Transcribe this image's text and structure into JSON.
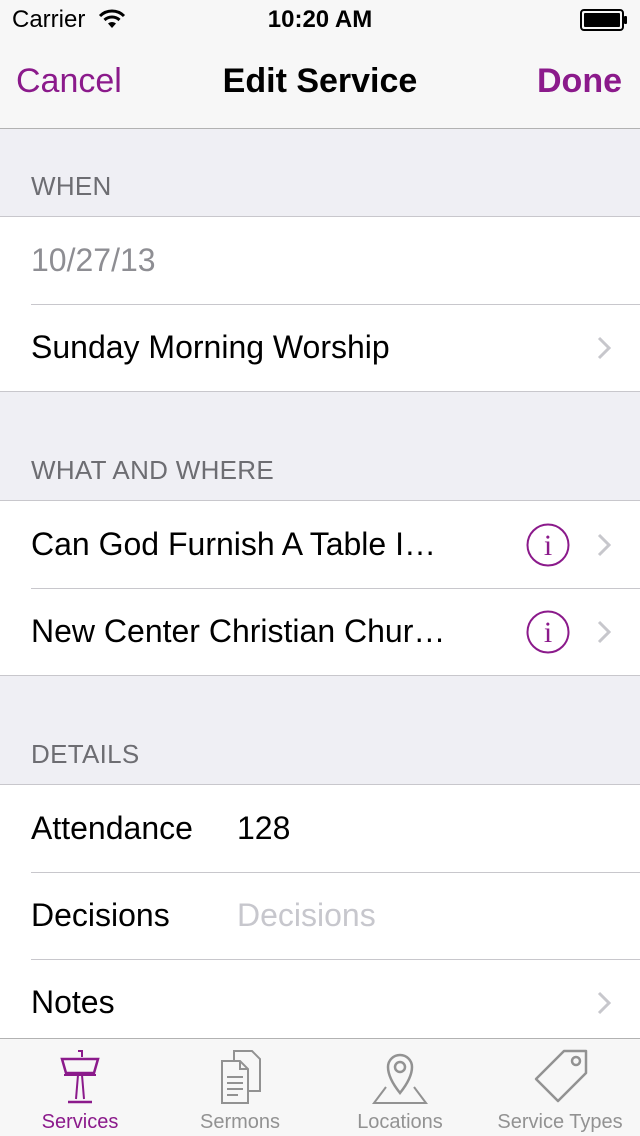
{
  "status": {
    "carrier": "Carrier",
    "time": "10:20 AM"
  },
  "nav": {
    "cancel": "Cancel",
    "title": "Edit Service",
    "done": "Done"
  },
  "sections": {
    "when": {
      "header": "WHEN",
      "date": "10/27/13",
      "service_type": "Sunday Morning Worship"
    },
    "what_where": {
      "header": "WHAT AND WHERE",
      "sermon": "Can God Furnish A Table I…",
      "location": "New Center Christian Chur…"
    },
    "details": {
      "header": "DETAILS",
      "attendance_label": "Attendance",
      "attendance_value": "128",
      "decisions_label": "Decisions",
      "decisions_placeholder": "Decisions",
      "notes_label": "Notes"
    }
  },
  "tabs": [
    {
      "label": "Services",
      "icon": "lectern-icon",
      "active": true
    },
    {
      "label": "Sermons",
      "icon": "documents-icon",
      "active": false
    },
    {
      "label": "Locations",
      "icon": "map-pin-icon",
      "active": false
    },
    {
      "label": "Service Types",
      "icon": "tag-icon",
      "active": false
    }
  ],
  "colors": {
    "accent": "#8b1a8b",
    "tab_inactive": "#929292",
    "section_header": "#6d6d72",
    "background": "#efeff4"
  }
}
